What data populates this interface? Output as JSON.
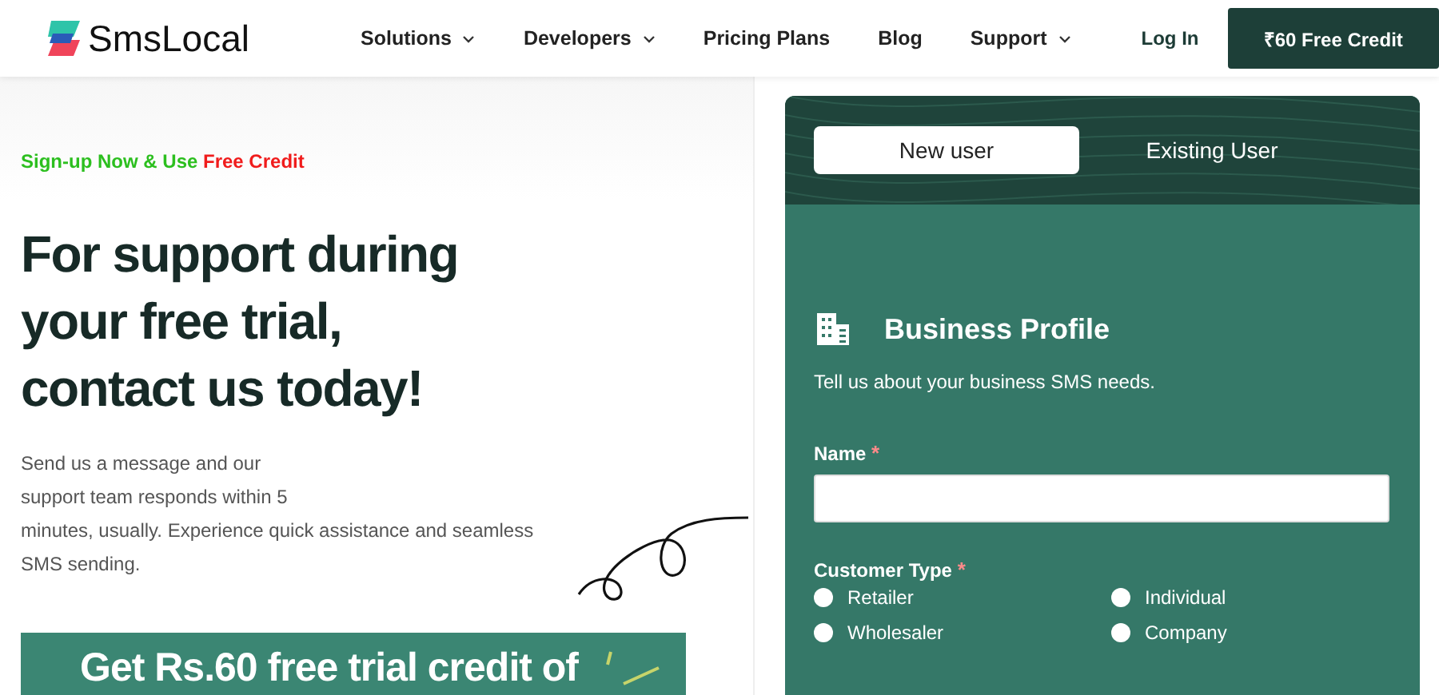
{
  "header": {
    "logo": "SmsLocal",
    "nav": [
      {
        "label": "Solutions",
        "dropdown": true
      },
      {
        "label": "Developers",
        "dropdown": true
      },
      {
        "label": "Pricing Plans",
        "dropdown": false
      },
      {
        "label": "Blog",
        "dropdown": false
      },
      {
        "label": "Support",
        "dropdown": true
      }
    ],
    "login": "Log In",
    "cta": "₹60 Free Credit"
  },
  "hero": {
    "eyebrow": "Sign-up Now & Use",
    "eyebrow_highlight": "Free Credit",
    "heading_lines": [
      "For support during",
      "your free trial,",
      "contact us today!"
    ],
    "body_lines": [
      "Send us a message and our",
      "support team responds within 5",
      "minutes, usually. Experience quick assistance and seamless",
      "SMS sending."
    ],
    "banner": "Get Rs.60 free trial credit of"
  },
  "form": {
    "tabs": [
      {
        "label": "New user",
        "selected": true
      },
      {
        "label": "Existing User",
        "selected": false
      }
    ],
    "title": "Business Profile",
    "subtitle": "Tell us about your business SMS needs.",
    "name_label": "Name",
    "name_marker": "*",
    "type_label": "Customer Type",
    "type_marker": "*",
    "options": [
      {
        "label": "Retailer",
        "selected": false
      },
      {
        "label": "Individual",
        "selected": false
      },
      {
        "label": "Wholesaler",
        "selected": false
      },
      {
        "label": "Company",
        "selected": false
      }
    ]
  }
}
